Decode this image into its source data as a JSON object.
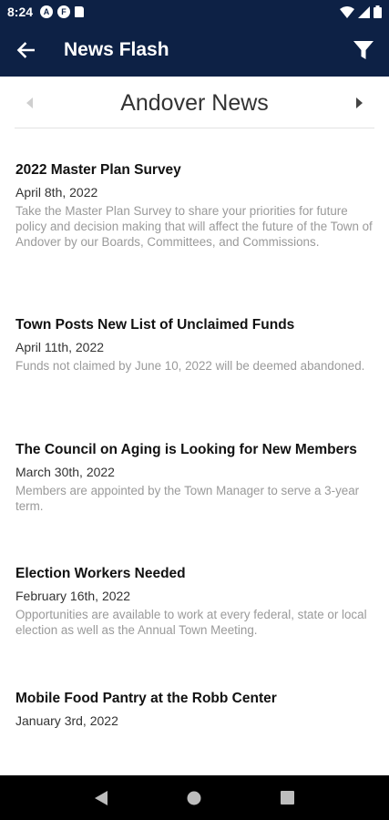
{
  "status_bar": {
    "time": "8:24",
    "icon_a": "A",
    "icon_f": "F"
  },
  "app_bar": {
    "title": "News Flash"
  },
  "selector": {
    "title": "Andover News"
  },
  "news": [
    {
      "title": "2022 Master Plan Survey",
      "date": "April 8th, 2022",
      "summary": "Take the Master Plan Survey to share your priorities for future policy and decision making that will affect the future of the Town of Andover by our Boards, Committees, and Commissions."
    },
    {
      "title": "Town Posts New List of Unclaimed Funds",
      "date": "April 11th, 2022",
      "summary": "Funds not claimed by June 10, 2022 will be deemed abandoned."
    },
    {
      "title": "The Council on Aging is Looking for New Members",
      "date": "March 30th, 2022",
      "summary": "Members are appointed by the Town Manager to serve a 3-year term."
    },
    {
      "title": "Election Workers Needed",
      "date": "February 16th, 2022",
      "summary": "Opportunities are available to work at every federal, state or local election as well as the Annual Town Meeting."
    },
    {
      "title": "Mobile Food Pantry at the Robb Center",
      "date": "January 3rd, 2022",
      "summary": ""
    }
  ],
  "colors": {
    "header_bg": "#0d2145",
    "summary_text": "#9a9a9a"
  }
}
